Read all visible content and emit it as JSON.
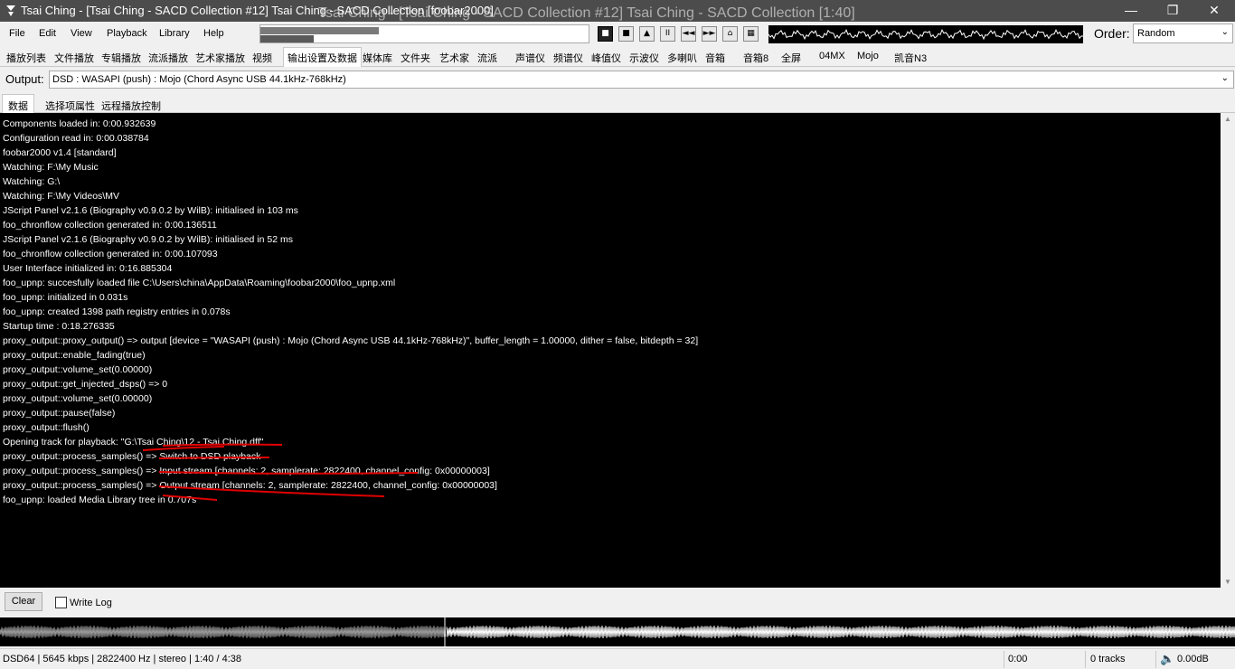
{
  "window": {
    "title": "Tsai Ching - [Tsai Ching - SACD Collection #12] Tsai Ching - SACD Collection  [foobar2000]",
    "ghost_title": "Tsai Ching - [Tsai Ching - SACD Collection #12] Tsai Ching - SACD Collection [1:40]",
    "minimize": "—",
    "maximize": "❐",
    "close": "✕"
  },
  "menu": {
    "file": "File",
    "edit": "Edit",
    "view": "View",
    "playback": "Playback",
    "library": "Library",
    "help": "Help"
  },
  "transport": {
    "stop": "■",
    "pause_stop": "■",
    "play": "▲",
    "pause": "II",
    "prev": "◄◄",
    "next": "►►",
    "random": "⌂",
    "settings": "▦"
  },
  "order": {
    "label": "Order:",
    "value": "Random"
  },
  "tabs": [
    "播放列表",
    "文件播放",
    "专辑播放",
    "流派播放",
    "艺术家播放",
    "视频",
    "输出设置及数据",
    "媒体库",
    "文件夹",
    "艺术家",
    "流派",
    "声谱仪",
    "频谱仪",
    "峰值仪",
    "示波仪",
    "多喇叭",
    "音箱",
    "音箱8",
    "全屏",
    "04MX",
    "Mojo",
    "凯音N3"
  ],
  "output": {
    "label": "Output:",
    "value": "DSD : WASAPI (push) : Mojo (Chord Async USB 44.1kHz-768kHz)"
  },
  "subtabs": [
    "数据",
    "选择项属性",
    "远程播放控制"
  ],
  "console_lines": [
    "Components loaded in: 0:00.932639",
    "Configuration read in: 0:00.038784",
    "foobar2000 v1.4 [standard]",
    "Watching: F:\\My Music",
    "Watching: G:\\",
    "Watching: F:\\My Videos\\MV",
    "JScript Panel v2.1.6 (Biography v0.9.0.2 by WilB): initialised in 103 ms",
    "foo_chronflow collection generated in: 0:00.136511",
    "JScript Panel v2.1.6 (Biography v0.9.0.2 by WilB): initialised in 52 ms",
    "foo_chronflow collection generated in: 0:00.107093",
    "User Interface initialized in: 0:16.885304",
    "foo_upnp: succesfully loaded file C:\\Users\\china\\AppData\\Roaming\\foobar2000\\foo_upnp.xml",
    "foo_upnp: initialized in 0.031s",
    "foo_upnp: created 1398 path registry entries in 0.078s",
    "Startup time : 0:18.276335",
    "proxy_output::proxy_output() => output [device = \"WASAPI (push) : Mojo (Chord Async USB 44.1kHz-768kHz)\", buffer_length = 1.00000, dither = false, bitdepth = 32]",
    "proxy_output::enable_fading(true)",
    "proxy_output::volume_set(0.00000)",
    "proxy_output::get_injected_dsps() => 0",
    "proxy_output::volume_set(0.00000)",
    "proxy_output::pause(false)",
    "proxy_output::flush()",
    "Opening track for playback: \"G:\\Tsai Ching\\12 - Tsai Ching.dff\"",
    "proxy_output::process_samples() => Switch to DSD playback",
    "proxy_output::process_samples() => Input stream [channels: 2, samplerate: 2822400, channel_config: 0x00000003]",
    "proxy_output::process_samples() => Output stream [channels: 2, samplerate: 2822400, channel_config: 0x00000003]",
    "foo_upnp: loaded Media Library tree in 0.707s"
  ],
  "controls": {
    "clear": "Clear",
    "write_log": "Write Log"
  },
  "status": {
    "format": "DSD64 | 5645 kbps | 2822400 Hz | stereo | 1:40 / 4:38",
    "time": "0:00",
    "tracks": "0 tracks",
    "volume": "0.00dB"
  },
  "playback_progress": 0.36,
  "colors": {
    "titlebar": "#4c4c4c",
    "console_bg": "#000000",
    "console_text": "#ffffff",
    "annotation": "#e00000"
  }
}
